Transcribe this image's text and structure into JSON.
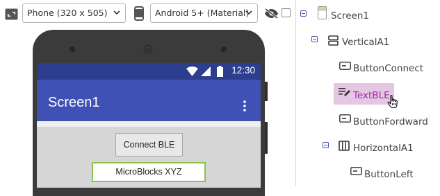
{
  "toolbar": {
    "device_select": "Phone (320 x 505)",
    "theme_select": "Android 5+ (Material)"
  },
  "phone": {
    "status_time": "12:30",
    "app_title": "Screen1",
    "connect_button": "Connect BLE",
    "text_value": "MicroBlocks XYZ"
  },
  "tree": {
    "items": [
      {
        "label": "Screen1"
      },
      {
        "label": "VerticalA1"
      },
      {
        "label": "ButtonConnect"
      },
      {
        "label": "TextBLE"
      },
      {
        "label": "ButtonFordward"
      },
      {
        "label": "HorizontalA1"
      },
      {
        "label": "ButtonLeft"
      }
    ]
  },
  "colors": {
    "app_bar": "#3f51b5",
    "status_bar": "#2d3e8f",
    "selection": "#e5c6e3",
    "selected_text": "#9c27b0",
    "textbox_border": "#8bc34a"
  }
}
